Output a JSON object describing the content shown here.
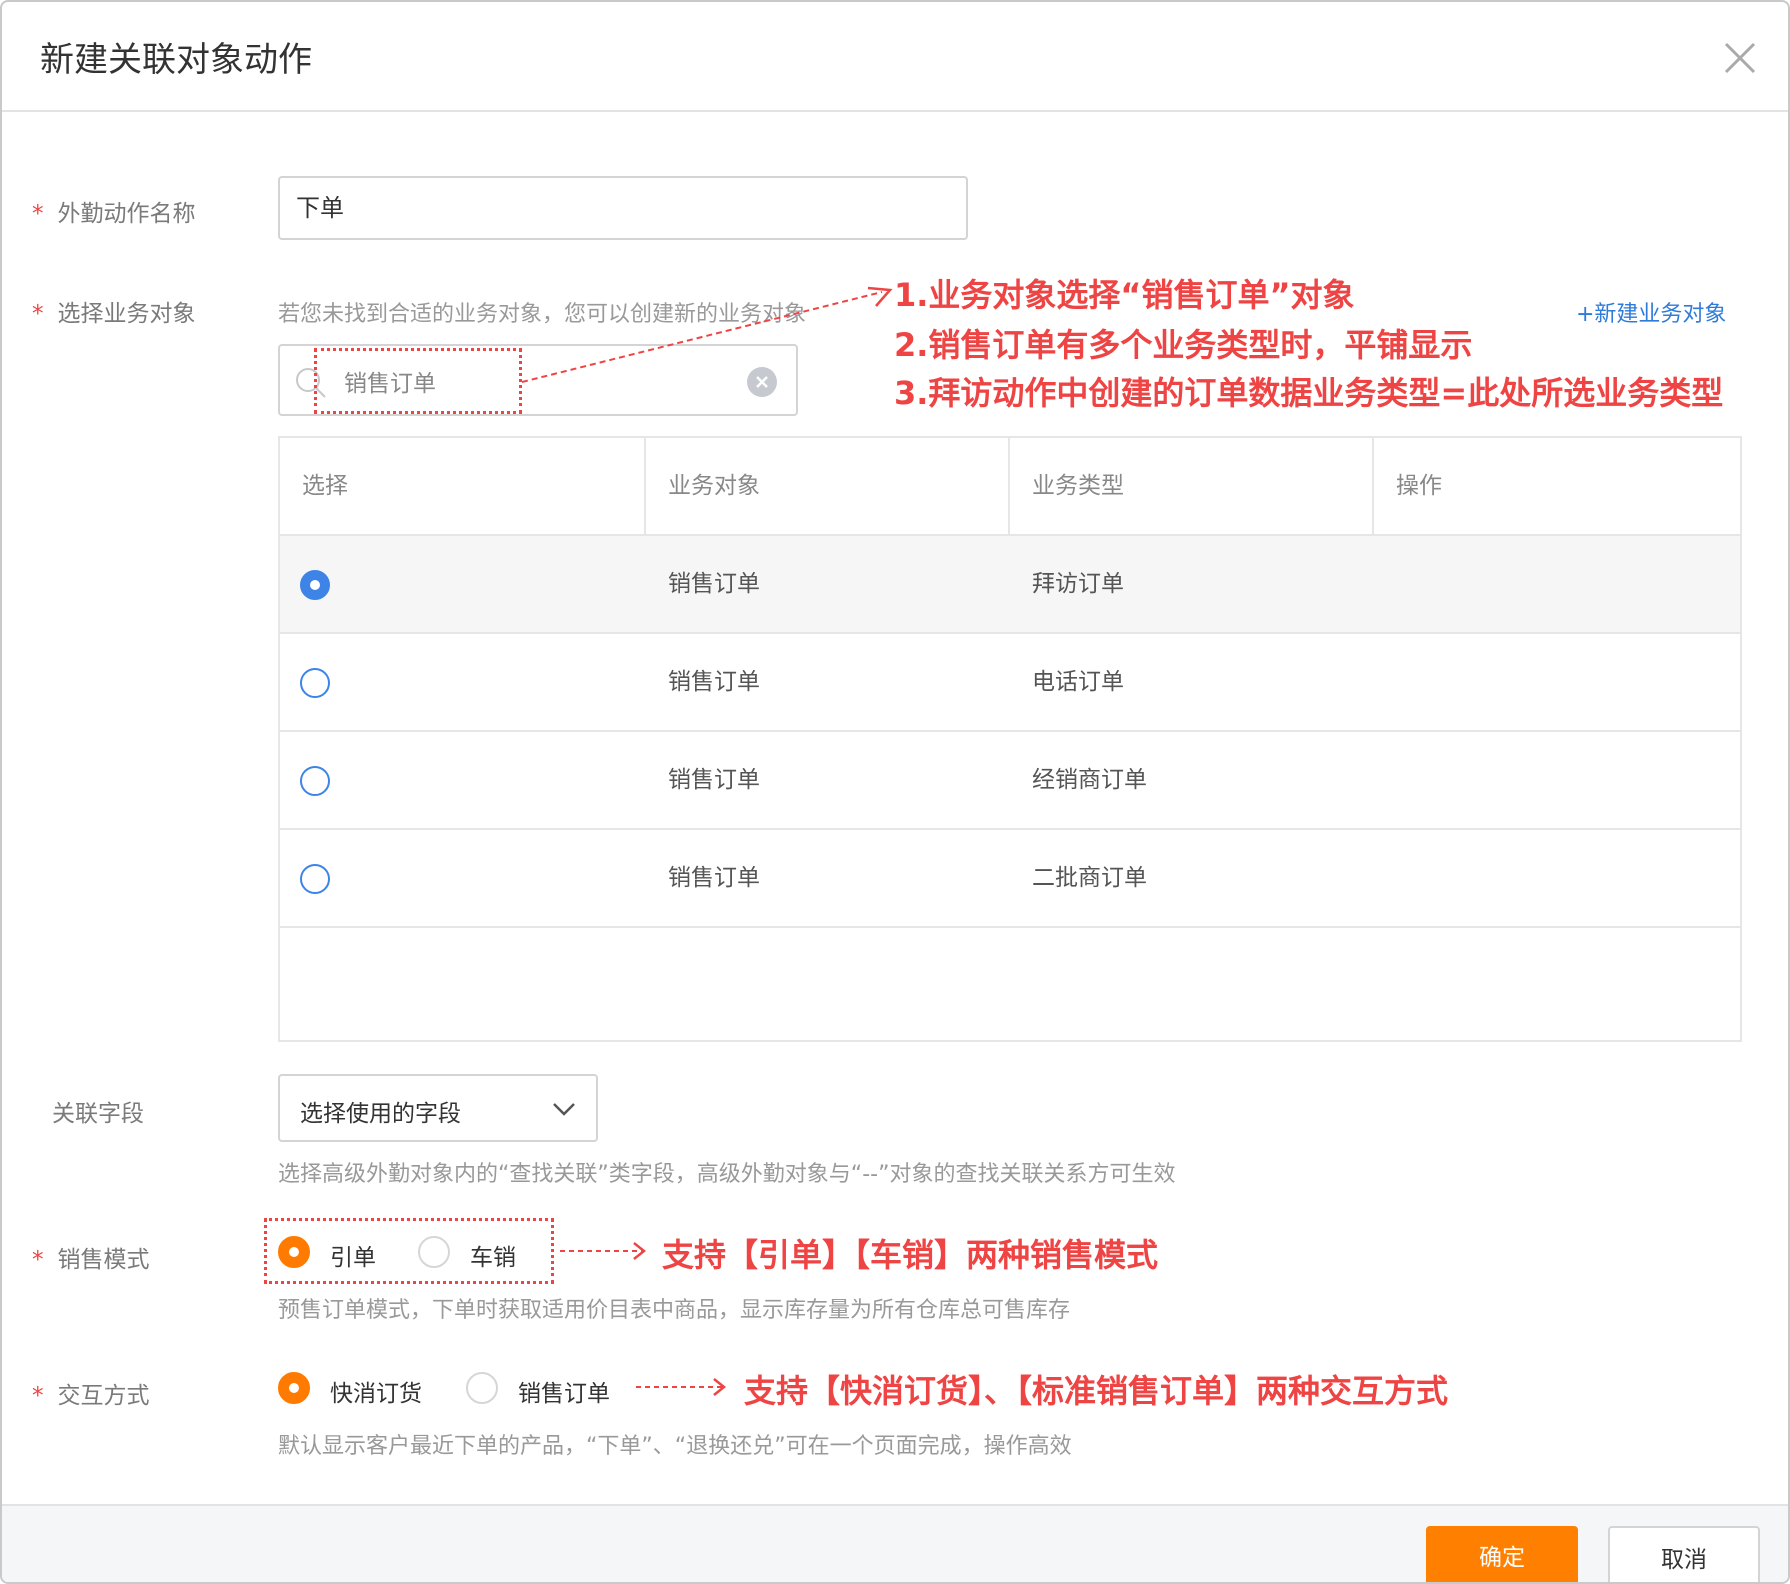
{
  "dialog": {
    "title": "新建关联对象动作",
    "close_icon": "close-icon"
  },
  "form": {
    "action_name": {
      "label": "外勤动作名称",
      "value": "下单"
    },
    "business_object": {
      "label": "选择业务对象",
      "hint": "若您未找到合适的业务对象，您可以创建新的业务对象",
      "create_link": "+新建业务对象",
      "search_value": "销售订单",
      "search_icon": "search-icon",
      "clear_icon": "clear-icon"
    },
    "table": {
      "columns": [
        "选择",
        "业务对象",
        "业务类型",
        "操作"
      ],
      "rows": [
        {
          "object": "销售订单",
          "type": "拜访订单",
          "selected": true
        },
        {
          "object": "销售订单",
          "type": "电话订单",
          "selected": false
        },
        {
          "object": "销售订单",
          "type": "经销商订单",
          "selected": false
        },
        {
          "object": "销售订单",
          "type": "二批商订单",
          "selected": false
        }
      ]
    },
    "related_field": {
      "label": "关联字段",
      "placeholder": "选择使用的字段",
      "hint": "选择高级外勤对象内的“查找关联”类字段，高级外勤对象与“--”对象的查找关联关系方可生效",
      "chevron_icon": "chevron-down-icon"
    },
    "sales_mode": {
      "label": "销售模式",
      "options": [
        "引单",
        "车销"
      ],
      "selected": "引单",
      "hint": "预售订单模式，下单时获取适用价目表中商品，显示库存量为所有仓库总可售库存"
    },
    "interaction": {
      "label": "交互方式",
      "options": [
        "快消订货",
        "销售订单"
      ],
      "selected": "快消订货",
      "hint": "默认显示客户最近下单的产品，“下单”、“退换还兑”可在一个页面完成，操作高效"
    }
  },
  "annotations": {
    "object_notes": [
      "1.业务对象选择“销售订单”对象",
      "2.销售订单有多个业务类型时，平铺显示",
      "3.拜访动作中创建的订单数据业务类型=此处所选业务类型"
    ],
    "sales_mode_note": "支持【引单】【车销】两种销售模式",
    "interaction_note": "支持【快消订货】、【标准销售订单】两种交互方式",
    "color": "#ee4444"
  },
  "footer": {
    "ok": "确定",
    "cancel": "取消"
  },
  "colors": {
    "primary": "#ff7f00",
    "radio_blue": "#3d84e6",
    "link": "#2f7bd9"
  }
}
